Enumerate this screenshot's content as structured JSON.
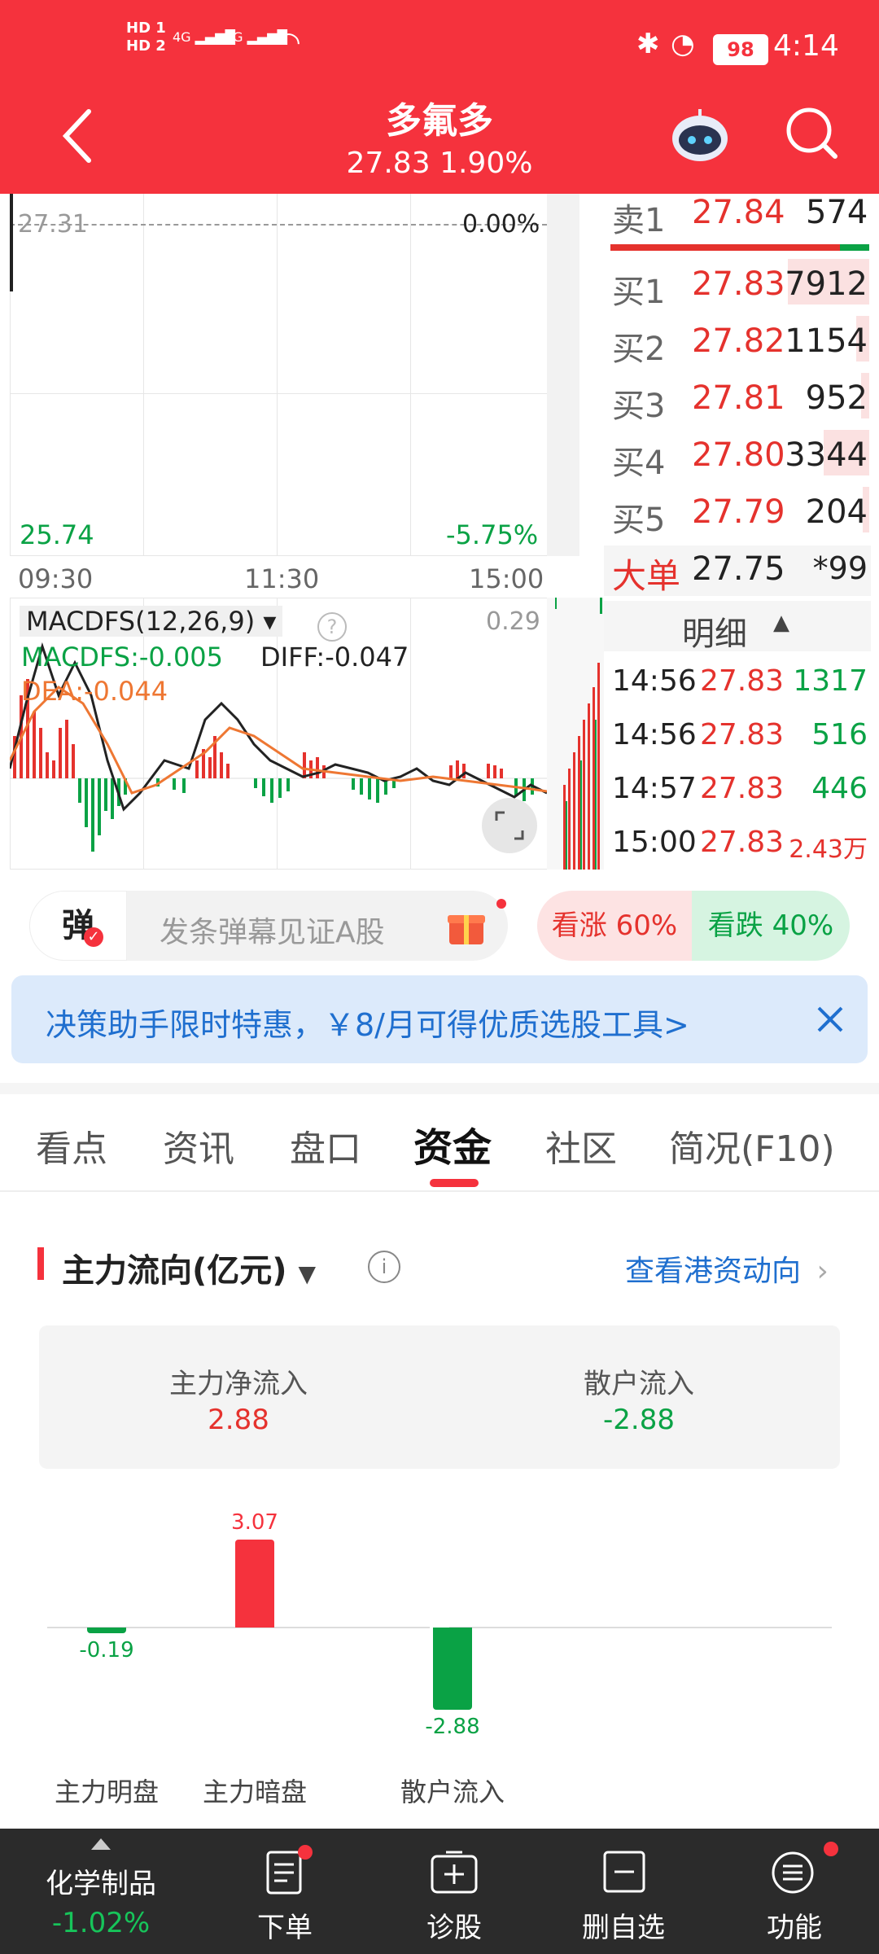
{
  "status": {
    "time": "4:14",
    "battery": "98",
    "net1": "4G",
    "net2": "4G",
    "hd1": "HD 1",
    "hd2": "HD 2"
  },
  "header": {
    "title": "多氟多",
    "price": "27.83",
    "pct": "1.90%"
  },
  "chart": {
    "ref_price": "27.31",
    "ref_pct": "0.00%",
    "low_price": "25.74",
    "low_pct": "-5.75%",
    "times": [
      "09:30",
      "11:30",
      "15:00"
    ]
  },
  "macd": {
    "title": "MACDFS(12,26,9)",
    "macdfs": "MACDFS:-0.005",
    "diff": "DIFF:-0.047",
    "dea": "DEA:-0.044",
    "max": "0.29"
  },
  "orderbook": {
    "sell1": {
      "label": "卖1",
      "price": "27.84",
      "vol": "574"
    },
    "buys": [
      {
        "label": "买1",
        "price": "27.83",
        "vol": "7912"
      },
      {
        "label": "买2",
        "price": "27.82",
        "vol": "1154"
      },
      {
        "label": "买3",
        "price": "27.81",
        "vol": "952"
      },
      {
        "label": "买4",
        "price": "27.80",
        "vol": "3344"
      },
      {
        "label": "买5",
        "price": "27.79",
        "vol": "204"
      }
    ],
    "big": {
      "label": "大单",
      "price": "27.75",
      "vol": "*99"
    },
    "detail_label": "明细",
    "ticks": [
      {
        "time": "14:56",
        "price": "27.83",
        "vol": "1317"
      },
      {
        "time": "14:56",
        "price": "27.83",
        "vol": "516"
      },
      {
        "time": "14:57",
        "price": "27.83",
        "vol": "446"
      },
      {
        "time": "15:00",
        "price": "27.83",
        "vol": "2.43万"
      }
    ]
  },
  "danmu": {
    "badge": "弹",
    "placeholder": "发条弹幕见证A股",
    "bull": "看涨 60%",
    "bear": "看跌 40%"
  },
  "promo": {
    "text": "决策助手限时特惠，￥8/月可得优质选股工具>"
  },
  "tabs": [
    "看点",
    "资讯",
    "盘口",
    "资金",
    "社区",
    "简况(F10)"
  ],
  "active_tab": 3,
  "flow": {
    "title": "主力流向(亿元)",
    "link": "查看港资动向",
    "net_in_label": "主力净流入",
    "net_in_value": "2.88",
    "retail_label": "散户流入",
    "retail_value": "-2.88"
  },
  "chart_data": {
    "type": "bar",
    "categories": [
      "主力明盘",
      "主力暗盘",
      "散户流入"
    ],
    "values": [
      -0.19,
      3.07,
      -2.88
    ],
    "value_labels": [
      "-0.19",
      "3.07",
      "-2.88"
    ],
    "colors": {
      "positive": "#f5323d",
      "negative": "#0aa245"
    }
  },
  "bottom": {
    "sector": "化学制品",
    "sector_pct": "-1.02%",
    "items": [
      "下单",
      "诊股",
      "删自选",
      "功能"
    ]
  },
  "colors": {
    "brand": "#f5323d",
    "up": "#e5322d",
    "down": "#0aa245",
    "promo_bg": "#dceafb"
  }
}
